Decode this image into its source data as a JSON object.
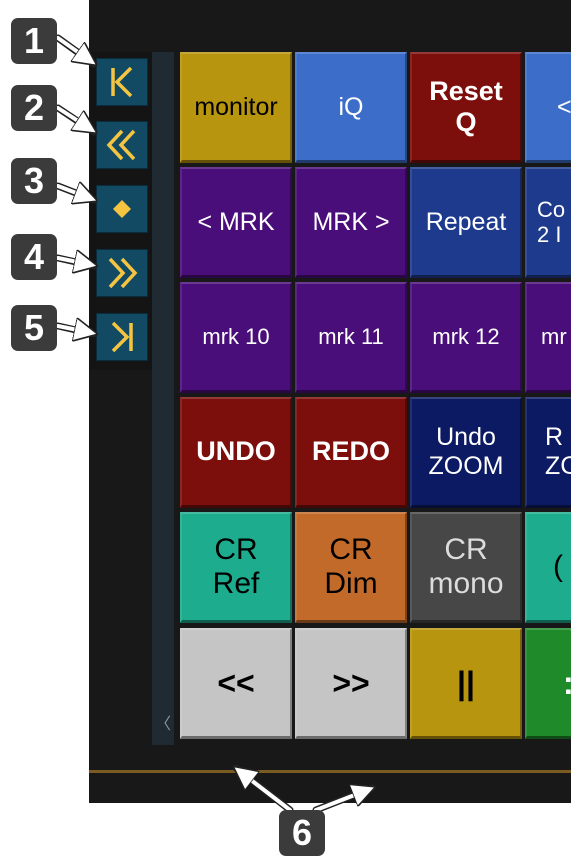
{
  "callouts": [
    "1",
    "2",
    "3",
    "4",
    "5",
    "6"
  ],
  "nav_buttons": [
    {
      "icon": "skip-to-start-icon"
    },
    {
      "icon": "rewind-icon"
    },
    {
      "icon": "diamond-marker-icon"
    },
    {
      "icon": "fast-forward-icon"
    },
    {
      "icon": "skip-to-end-icon"
    }
  ],
  "colors": {
    "nav_accent": "#f5c542",
    "nav_bg": "#124a64",
    "frame_bg": "#181818",
    "timeline_bar": "#7a5c22"
  },
  "collapse_handle": "〈",
  "grid": {
    "r1": {
      "monitor": "monitor",
      "iq": "iQ",
      "reset_l1": "Reset",
      "reset_l2": "Q",
      "c4": "<"
    },
    "r2": {
      "prev_mrk": "< MRK",
      "next_mrk": "MRK >",
      "repeat": "Repeat",
      "c4_l1": "Co",
      "c4_l2": "2 I"
    },
    "r3": {
      "mrk10": "mrk 10",
      "mrk11": "mrk 11",
      "mrk12": "mrk 12",
      "c4": "mr"
    },
    "r4": {
      "undo": "UNDO",
      "redo": "REDO",
      "undo_zoom_l1": "Undo",
      "undo_zoom_l2": "ZOOM",
      "c4_l1": "R",
      "c4_l2": "ZC"
    },
    "r5": {
      "cr_ref_l1": "CR",
      "cr_ref_l2": "Ref",
      "cr_dim_l1": "CR",
      "cr_dim_l2": "Dim",
      "cr_mono_l1": "CR",
      "cr_mono_l2": "mono",
      "c4": "("
    },
    "r6": {
      "rewind": "<<",
      "forward": ">>",
      "pause": "||",
      "c4": ":"
    }
  }
}
